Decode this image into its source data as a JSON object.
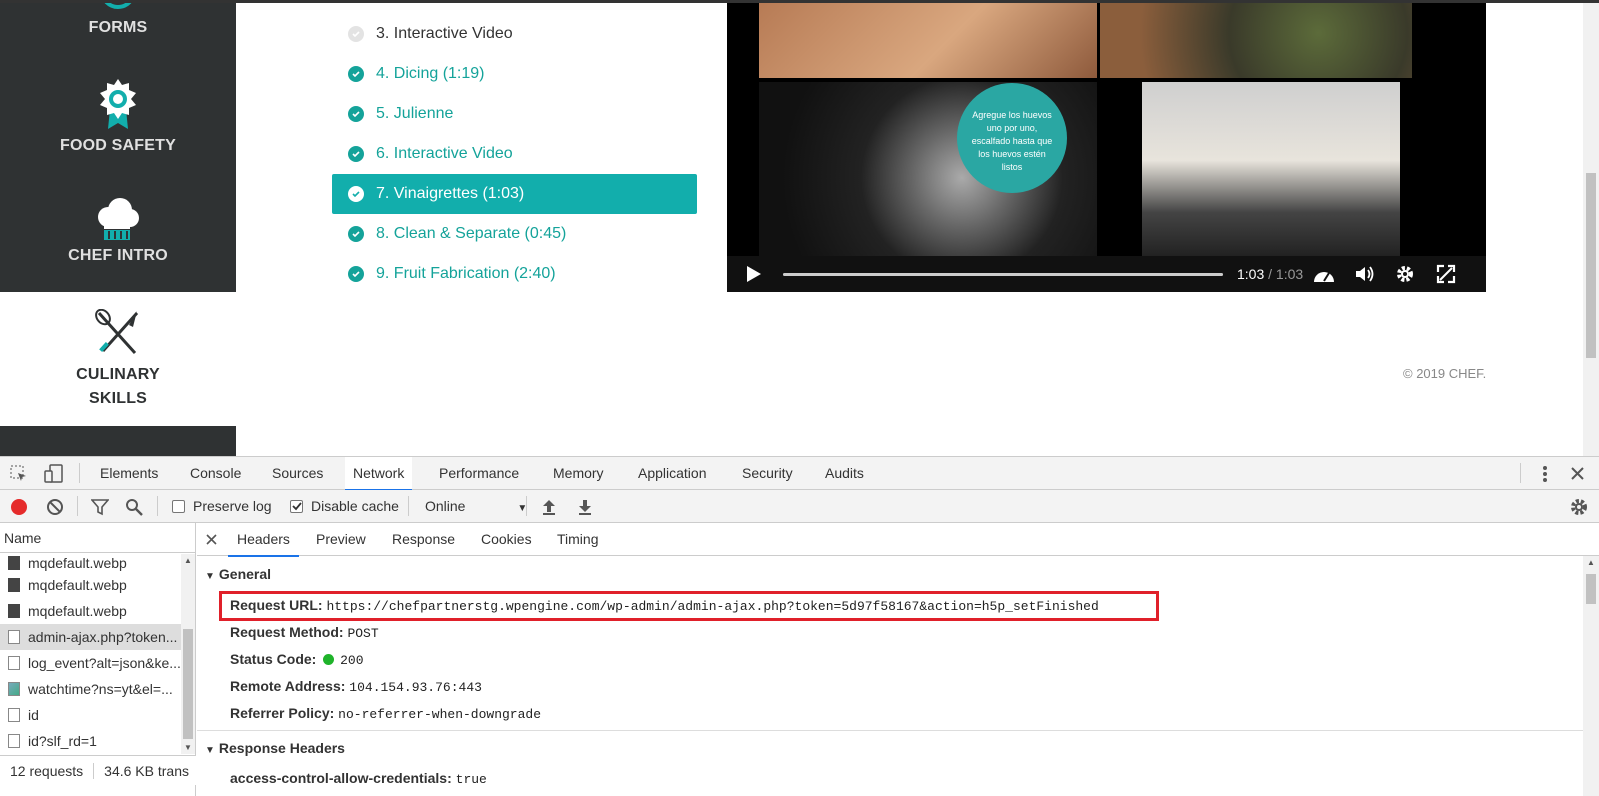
{
  "sidebar": {
    "items": [
      {
        "label": "FORMS",
        "icon": "forms-icon"
      },
      {
        "label": "FOOD SAFETY",
        "icon": "food-safety-icon"
      },
      {
        "label": "CHEF INTRO",
        "icon": "chef-hat-icon"
      },
      {
        "label_line1": "CULINARY",
        "label_line2": "SKILLS",
        "icon": "crossed-knives-icon"
      }
    ]
  },
  "lessons": [
    {
      "label": "3. Interactive Video",
      "state": "incomplete"
    },
    {
      "label": "4. Dicing (1:19)",
      "state": "complete"
    },
    {
      "label": "5. Julienne",
      "state": "complete"
    },
    {
      "label": "6. Interactive Video",
      "state": "complete"
    },
    {
      "label": "7. Vinaigrettes (1:03)",
      "state": "active"
    },
    {
      "label": "8. Clean & Separate (0:45)",
      "state": "complete"
    },
    {
      "label": "9. Fruit Fabrication (2:40)",
      "state": "complete"
    }
  ],
  "video": {
    "overlay_text": "Agregue los huevos uno por uno, escalfado hasta que los huevos estén listos",
    "current_time": "1:03",
    "total_time": "/ 1:03",
    "progress": 1.0
  },
  "footer": {
    "copyright": "© 2019 CHEF."
  },
  "devtools": {
    "tabs": [
      "Elements",
      "Console",
      "Sources",
      "Network",
      "Performance",
      "Memory",
      "Application",
      "Security",
      "Audits"
    ],
    "active_tab": "Network",
    "toolbar": {
      "preserve_log": "Preserve log",
      "preserve_log_checked": false,
      "disable_cache": "Disable cache",
      "disable_cache_checked": true,
      "throttle": "Online"
    },
    "name_header": "Name",
    "requests": [
      {
        "name": "mqdefault.webp",
        "type": "img"
      },
      {
        "name": "mqdefault.webp",
        "type": "img"
      },
      {
        "name": "mqdefault.webp",
        "type": "img"
      },
      {
        "name": "admin-ajax.php?token...",
        "type": "doc",
        "selected": true
      },
      {
        "name": "log_event?alt=json&ke...",
        "type": "doc"
      },
      {
        "name": "watchtime?ns=yt&el=...",
        "type": "img"
      },
      {
        "name": "id",
        "type": "doc"
      },
      {
        "name": "id?slf_rd=1",
        "type": "doc"
      }
    ],
    "status": {
      "requests": "12 requests",
      "transferred": "34.6 KB trans"
    },
    "detail_tabs": [
      "Headers",
      "Preview",
      "Response",
      "Cookies",
      "Timing"
    ],
    "active_detail_tab": "Headers",
    "general": {
      "title": "General",
      "rows": [
        {
          "k": "Request URL:",
          "v": "https://chefpartnerstg.wpengine.com/wp-admin/admin-ajax.php?token=5d97f58167&action=h5p_setFinished"
        },
        {
          "k": "Request Method:",
          "v": "POST"
        },
        {
          "k": "Status Code:",
          "v": "200"
        },
        {
          "k": "Remote Address:",
          "v": "104.154.93.76:443"
        },
        {
          "k": "Referrer Policy:",
          "v": "no-referrer-when-downgrade"
        }
      ]
    },
    "response_headers": {
      "title": "Response Headers",
      "rows": [
        {
          "k": "access-control-allow-credentials:",
          "v": "true"
        }
      ]
    }
  },
  "colors": {
    "accent": "#12aeac",
    "sidebar": "#2f3233",
    "highlight": "#e0202a"
  }
}
